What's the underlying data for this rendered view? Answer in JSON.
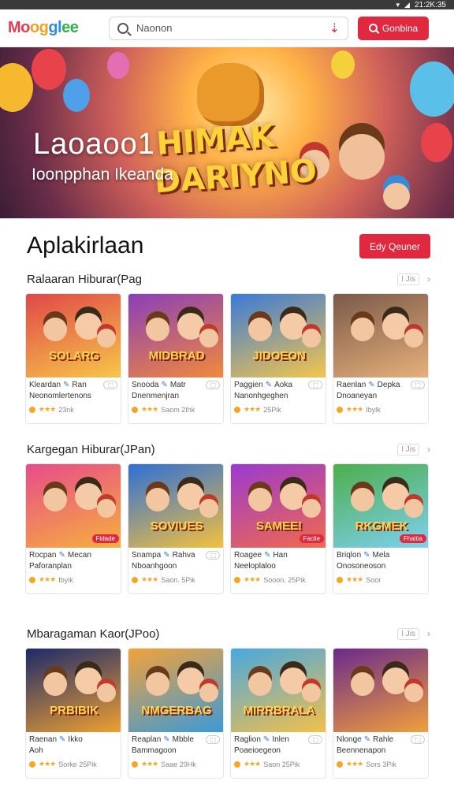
{
  "status": {
    "time": "21:2K:35"
  },
  "topbar": {
    "logo_parts": [
      "Mo",
      "og",
      "gl",
      "ee"
    ],
    "search_placeholder": "Naonon",
    "cta_label": "Gonbina"
  },
  "hero": {
    "title": "Laoaoo1",
    "subtitle": "Ioonpphan Ikeanda",
    "art_line1": "HIMAK",
    "art_line2": "DARIYNO"
  },
  "page": {
    "heading": "Aplakirlaan",
    "heading_button": "Edy Qeuner"
  },
  "sections": [
    {
      "title": "Ralaaran Hiburar(Pag",
      "more": "I Jis",
      "cards": [
        {
          "art": "SOLARG",
          "name": "Kleardan",
          "tail": "Ran",
          "line2": "Neonomlertenons",
          "rating": "23nk",
          "pill": "⬚",
          "bg": [
            "#e04848",
            "#f7c748"
          ]
        },
        {
          "art": "MIDBRAD",
          "name": "Snooda",
          "tail": "Matr",
          "line2": "Dnenmenjran",
          "rating": "Saom 2Ihk",
          "pill": "⬚",
          "bg": [
            "#8a3fb8",
            "#f28a3a"
          ]
        },
        {
          "art": "JIDOEON",
          "name": "Paggien",
          "tail": "Aoka",
          "line2": "Nanonhgeghen",
          "rating": "25Pik",
          "pill": "⬚",
          "bg": [
            "#3a7ad8",
            "#f4c64a"
          ]
        },
        {
          "art": "",
          "name": "Raenlan",
          "tail": "Depka",
          "line2": "Dnoaneyan",
          "rating": "Ibylk",
          "pill": "⬚",
          "bg": [
            "#7a5a4a",
            "#e7b07a"
          ]
        }
      ]
    },
    {
      "title": "Kargegan Hiburar(JPan)",
      "more": "I Jis",
      "cards": [
        {
          "art": "",
          "name": "Rocpan",
          "tail": "Mecan",
          "line2": "Paforanplan",
          "rating": "Ibyik",
          "pill": "Fidade",
          "bg": [
            "#e84b8a",
            "#f6b03c"
          ]
        },
        {
          "art": "SOVIUES",
          "name": "Snampa",
          "tail": "Rahva",
          "line2": "Nboanhgoon",
          "rating": "Saon. 5Pik",
          "pill": "⬚",
          "bg": [
            "#2e6fd6",
            "#f4c13c"
          ]
        },
        {
          "art": "SAMEE!",
          "name": "Roagee",
          "tail": "Han",
          "line2": "Neeloplaloo",
          "rating": "Sooon. 25Pik",
          "pill": "Faclie",
          "bg": [
            "#9a3ad0",
            "#f26a4a"
          ]
        },
        {
          "art": "RKGMEK",
          "name": "Briqlon",
          "tail": "Mela",
          "line2": "Onosoneoson",
          "rating": "Soor",
          "pill": "Fhaitia",
          "bg": [
            "#4cae4c",
            "#7fd0f0"
          ]
        }
      ]
    },
    {
      "title": "Mbaragaman Kaor(JPoo)",
      "more": "I Jis",
      "cards": [
        {
          "art": "PRBIBIK",
          "name": "Raenan",
          "tail": "Ikko",
          "line2": "Aoh",
          "rating": "Sorke 25Pik",
          "pill": "",
          "bg": [
            "#1c2a6a",
            "#f0a030"
          ]
        },
        {
          "art": "NMGERBAG",
          "name": "Reaplan",
          "tail": "Mbble",
          "line2": "Bammagoon",
          "rating": "Saae 29Hk",
          "pill": "⬚",
          "bg": [
            "#f2a23a",
            "#3a9ad8"
          ]
        },
        {
          "art": "MIRRBRALA",
          "name": "Raglion",
          "tail": "Inlen",
          "line2": "Poaeioegeon",
          "rating": "Saon 25Pik",
          "pill": "⬚",
          "bg": [
            "#48a8e0",
            "#f4c048"
          ]
        },
        {
          "art": "",
          "name": "Nlonge",
          "tail": "Rahle",
          "line2": "Beennenapon",
          "rating": "Sors 3Pik",
          "pill": "⬚",
          "bg": [
            "#6a2a8a",
            "#f2a03a"
          ]
        }
      ]
    }
  ]
}
